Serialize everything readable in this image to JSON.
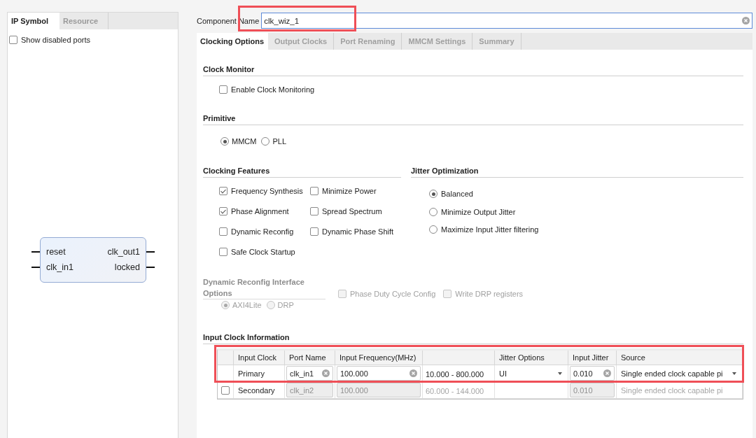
{
  "left_panel": {
    "tabs": [
      {
        "label": "IP Symbol",
        "selected": true
      },
      {
        "label": "Resource",
        "selected": false
      }
    ],
    "show_disabled_ports": {
      "label": "Show disabled ports",
      "checked": false
    },
    "ip_symbol": {
      "inputs": [
        "reset",
        "clk_in1"
      ],
      "outputs": [
        "clk_out1",
        "locked"
      ]
    }
  },
  "component_name": {
    "label": "Component Name",
    "value": "clk_wiz_1",
    "highlighted": true
  },
  "tabs": [
    {
      "label": "Clocking Options",
      "selected": true
    },
    {
      "label": "Output Clocks",
      "selected": false
    },
    {
      "label": "Port Renaming",
      "selected": false
    },
    {
      "label": "MMCM Settings",
      "selected": false
    },
    {
      "label": "Summary",
      "selected": false
    }
  ],
  "clock_monitor": {
    "title": "Clock Monitor",
    "options": [
      {
        "label": "Enable Clock Monitoring",
        "checked": false
      }
    ]
  },
  "primitive": {
    "title": "Primitive",
    "options": [
      {
        "label": "MMCM",
        "selected": true
      },
      {
        "label": "PLL",
        "selected": false
      }
    ]
  },
  "clocking_features": {
    "title": "Clocking Features",
    "options": [
      {
        "label": "Frequency Synthesis",
        "checked": true
      },
      {
        "label": "Minimize Power",
        "checked": false
      },
      {
        "label": "Phase Alignment",
        "checked": true
      },
      {
        "label": "Spread Spectrum",
        "checked": false
      },
      {
        "label": "Dynamic Reconfig",
        "checked": false
      },
      {
        "label": "Dynamic Phase Shift",
        "checked": false
      },
      {
        "label": "Safe Clock Startup",
        "checked": false
      }
    ]
  },
  "jitter_optimization": {
    "title": "Jitter Optimization",
    "options": [
      {
        "label": "Balanced",
        "selected": true
      },
      {
        "label": "Minimize Output Jitter",
        "selected": false
      },
      {
        "label": "Maximize Input Jitter filtering",
        "selected": false
      }
    ]
  },
  "dynamic_reconfig_interface": {
    "title": "Dynamic Reconfig Interface Options",
    "disabled": true,
    "interface_options": [
      {
        "label": "AXI4Lite",
        "selected": true
      },
      {
        "label": "DRP",
        "selected": false
      }
    ],
    "options": [
      {
        "label": "Phase Duty Cycle Config",
        "checked": false
      },
      {
        "label": "Write DRP registers",
        "checked": false
      }
    ]
  },
  "input_clock_information": {
    "title": "Input Clock Information",
    "highlighted": true,
    "columns": [
      "Input Clock",
      "Port Name",
      "Input Frequency(MHz)",
      "Jitter Options",
      "Input Jitter",
      "Source"
    ],
    "rows": [
      {
        "input_clock": "Primary",
        "port_name": "clk_in1",
        "input_frequency": "100.000",
        "frequency_range": "10.000 - 800.000",
        "jitter_options": "UI",
        "input_jitter": "0.010",
        "source": "Single ended clock capable pi",
        "disabled": false
      },
      {
        "enable_checkbox": {
          "checked": false
        },
        "input_clock": "Secondary",
        "port_name": "clk_in2",
        "input_frequency": "100.000",
        "frequency_range": "60.000 - 144.000",
        "input_jitter": "0.010",
        "source": "Single ended clock capable pi",
        "disabled": true
      }
    ]
  }
}
